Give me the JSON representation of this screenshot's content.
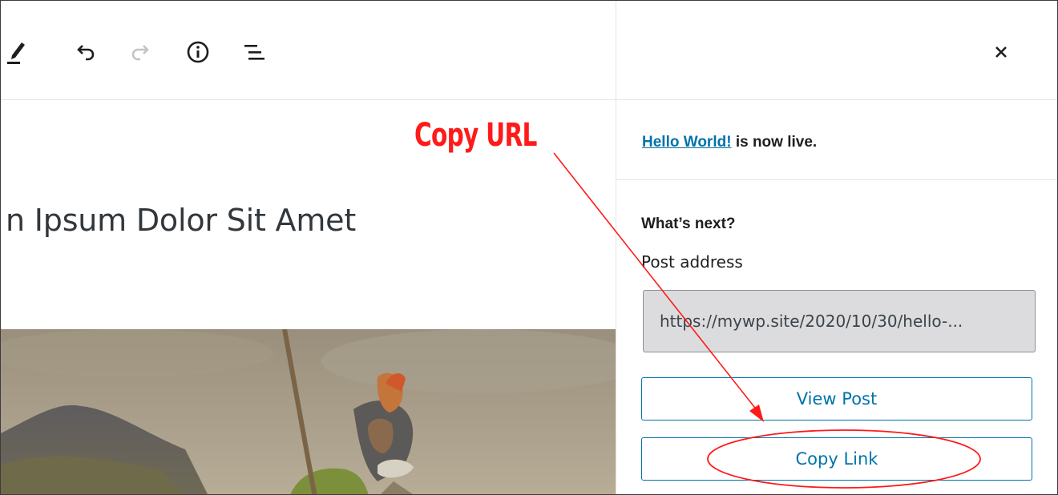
{
  "toolbar": {
    "tools": [
      {
        "name": "edit-tool-icon"
      },
      {
        "name": "undo-icon"
      },
      {
        "name": "redo-icon"
      },
      {
        "name": "info-icon"
      },
      {
        "name": "list-view-icon"
      }
    ]
  },
  "editor": {
    "post_title": "n Ipsum Dolor Sit Amet"
  },
  "sidebar": {
    "close_icon": "close-icon",
    "post_link_text": "Hello World!",
    "live_suffix": " is now live.",
    "whats_next": "What’s next?",
    "post_address_label": "Post address",
    "post_address_value": "https://mywp.site/2020/10/30/hello-...",
    "view_post_label": "View Post",
    "copy_link_label": "Copy Link"
  },
  "annotation": {
    "label": "Copy URL",
    "color": "#ff1a1a"
  },
  "colors": {
    "link": "#0073aa",
    "button_border": "#0073aa",
    "input_bg": "#dcdcde",
    "disabled_icon": "#c3c4c7"
  }
}
